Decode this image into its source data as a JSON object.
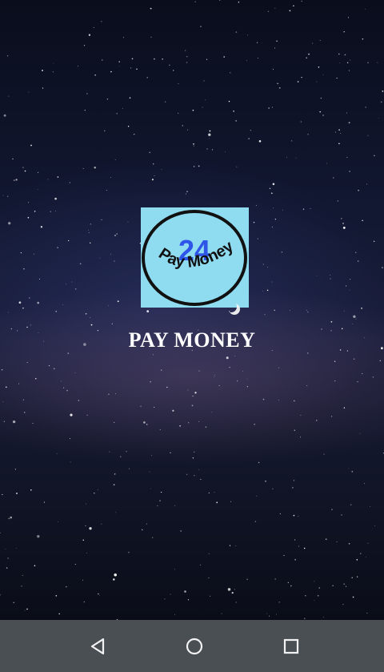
{
  "splash": {
    "logo_number": "24",
    "logo_text": "Pay Money",
    "app_name": "PAY MONEY"
  },
  "colors": {
    "logo_background": "#8fdcf0",
    "logo_number": "#2f55e8",
    "logo_ring": "#111111",
    "title_text": "#ffffff",
    "navbar_background": "#4a4f54",
    "navbar_icon": "#f2f2f2"
  },
  "navbar": {
    "buttons": [
      {
        "icon": "back-triangle-icon"
      },
      {
        "icon": "home-circle-icon"
      },
      {
        "icon": "recents-square-icon"
      }
    ]
  }
}
